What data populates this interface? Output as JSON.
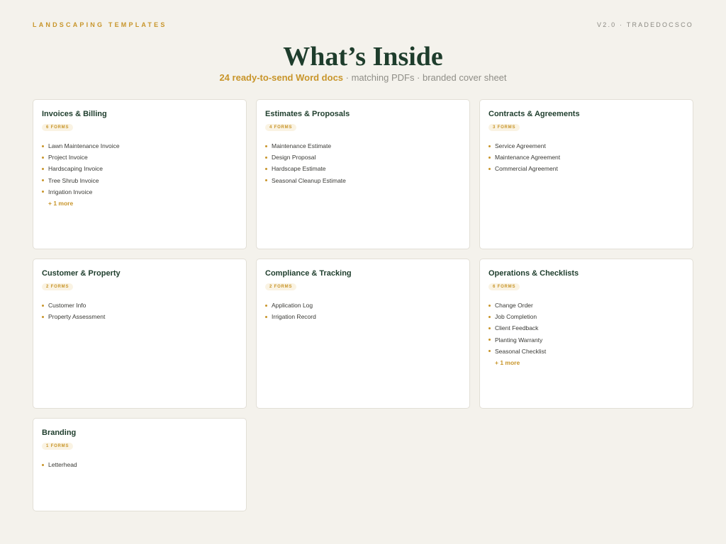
{
  "header": {
    "left_label": "LANDSCAPING TEMPLATES",
    "right_label": "V2.0 · TRADEDOCSCO",
    "title": "What’s Inside",
    "subtitle_highlight": "24 ready-to-send Word docs",
    "subtitle_rest": " · matching PDFs · branded cover sheet"
  },
  "colors": {
    "accent": "#c8952a",
    "heading": "#1e3d2c",
    "background": "#f4f2ec"
  },
  "cards": [
    {
      "title": "Invoices & Billing",
      "badge": "6 FORMS",
      "items": [
        "Lawn Maintenance Invoice",
        "Project Invoice",
        "Hardscaping Invoice",
        "Tree Shrub Invoice",
        "Irrigation Invoice"
      ],
      "more": "+ 1 more"
    },
    {
      "title": "Estimates & Proposals",
      "badge": "4 FORMS",
      "items": [
        "Maintenance Estimate",
        "Design Proposal",
        "Hardscape Estimate",
        "Seasonal Cleanup Estimate"
      ],
      "more": ""
    },
    {
      "title": "Contracts & Agreements",
      "badge": "3 FORMS",
      "items": [
        "Service Agreement",
        "Maintenance Agreement",
        "Commercial Agreement"
      ],
      "more": ""
    },
    {
      "title": "Customer & Property",
      "badge": "2 FORMS",
      "items": [
        "Customer Info",
        "Property Assessment"
      ],
      "more": ""
    },
    {
      "title": "Compliance & Tracking",
      "badge": "2 FORMS",
      "items": [
        "Application Log",
        "Irrigation Record"
      ],
      "more": ""
    },
    {
      "title": "Operations & Checklists",
      "badge": "6 FORMS",
      "items": [
        "Change Order",
        "Job Completion",
        "Client Feedback",
        "Planting Warranty",
        "Seasonal Checklist"
      ],
      "more": "+ 1 more"
    },
    {
      "title": "Branding",
      "badge": "1 FORMS",
      "items": [
        "Letterhead"
      ],
      "more": ""
    }
  ]
}
